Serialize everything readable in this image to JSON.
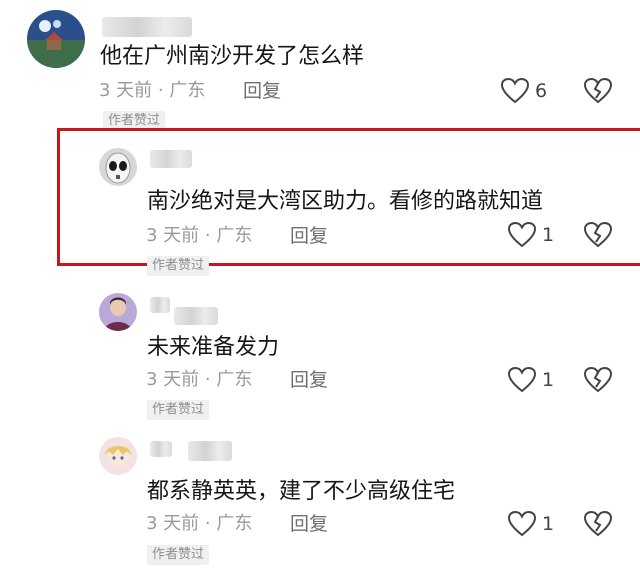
{
  "comments": [
    {
      "text": "他在广州南沙开发了怎么样",
      "meta": "3 天前 · 广东",
      "reply_label": "回复",
      "like_count": "6",
      "badge": "作者赞过",
      "avatar_icon": "landscape-avatar-icon"
    },
    {
      "text": "南沙绝对是大湾区助力。看修的路就知道",
      "meta": "3 天前 · 广东",
      "reply_label": "回复",
      "like_count": "1",
      "badge": "作者赞过",
      "avatar_icon": "mask-avatar-icon",
      "highlighted": true,
      "highlight_color": "#c8141e"
    },
    {
      "text": "未来准备发力",
      "meta": "3 天前 · 广东",
      "reply_label": "回复",
      "like_count": "1",
      "badge": "作者赞过",
      "avatar_icon": "person-avatar-icon"
    },
    {
      "text": "都系静英英，建了不少高级住宅",
      "meta": "3 天前 · 广东",
      "reply_label": "回复",
      "like_count": "1",
      "badge": "作者赞过",
      "avatar_icon": "anime-avatar-icon"
    }
  ],
  "icons": {
    "like": "heart-outline-icon",
    "dislike": "broken-heart-icon"
  }
}
